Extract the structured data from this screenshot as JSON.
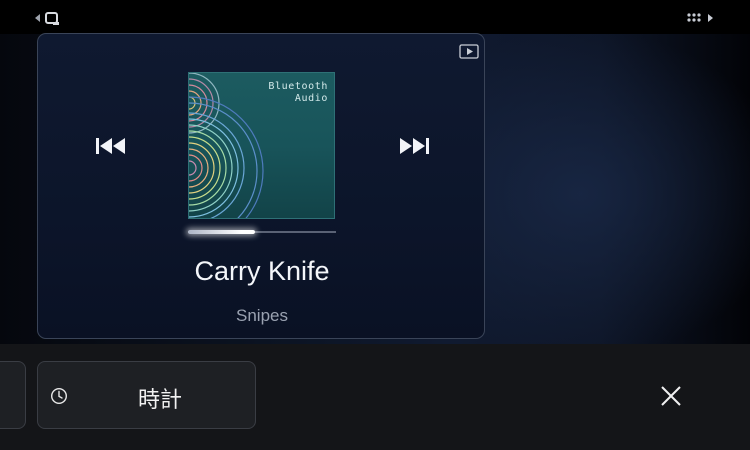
{
  "status_bar": {
    "left_icon": "back-arrow-device-icon",
    "right_icon": "app-grid-forward-icon"
  },
  "media_card": {
    "source_icon": "play-source-icon",
    "prev_icon": "skip-previous-icon",
    "next_icon": "skip-next-icon",
    "album": {
      "title_line1": "Bluetooth",
      "title_line2": "Audio"
    },
    "progress": 0.45,
    "song_title": "Carry Knife",
    "artist": "Snipes"
  },
  "tray": {
    "clock_tile": {
      "icon": "clock-icon",
      "label": "時計"
    },
    "close_icon": "close-icon"
  },
  "colors": {
    "card_border": "#3a4458",
    "album_bg": "#18545a",
    "tray_bg": "#141518"
  }
}
